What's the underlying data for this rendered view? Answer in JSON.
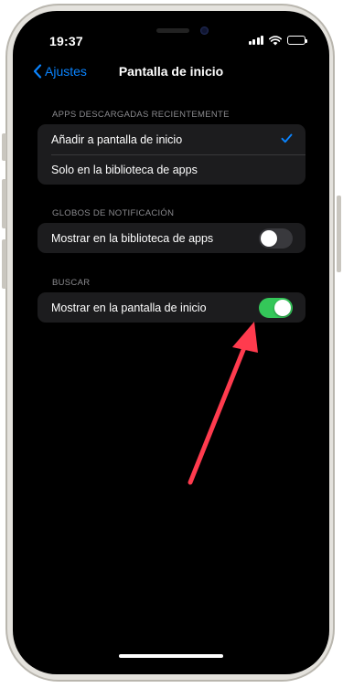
{
  "status_bar": {
    "time": "19:37",
    "icons": [
      "cellular-signal-icon",
      "wifi-icon",
      "battery-icon"
    ]
  },
  "nav": {
    "back_label": "Ajustes",
    "title": "Pantalla de inicio"
  },
  "sections": {
    "downloaded": {
      "header": "APPS DESCARGADAS RECIENTEMENTE",
      "options": [
        {
          "label": "Añadir a pantalla de inicio",
          "selected": true
        },
        {
          "label": "Solo en la biblioteca de apps",
          "selected": false
        }
      ]
    },
    "badges": {
      "header": "GLOBOS DE NOTIFICACIÓN",
      "row_label": "Mostrar en la biblioteca de apps",
      "toggle_on": false
    },
    "search": {
      "header": "BUSCAR",
      "row_label": "Mostrar en la pantalla de inicio",
      "toggle_on": true
    }
  },
  "colors": {
    "accent": "#0a84ff",
    "toggle_on": "#34c759",
    "annotation_arrow": "#ff3b4e"
  }
}
